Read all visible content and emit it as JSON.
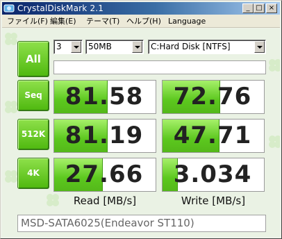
{
  "window": {
    "title": "CrystalDiskMark 2.1",
    "caption_buttons": {
      "minimize": "_",
      "maximize": "□",
      "close": "×"
    }
  },
  "menu": {
    "items": [
      "ファイル(F)",
      "編集(E)",
      "テーマ(T)",
      "ヘルプ(H)",
      "Language"
    ]
  },
  "controls": {
    "all_label": "All",
    "test_count": "3",
    "test_size": "50MB",
    "drive": "C:Hard Disk [NTFS]",
    "status": ""
  },
  "tests": {
    "seq": {
      "label": "Seq",
      "read": "81.58",
      "write": "72.76",
      "read_fill": 0.53,
      "write_fill": 0.57
    },
    "k512": {
      "label": "512K",
      "read": "81.19",
      "write": "47.71",
      "read_fill": 0.53,
      "write_fill": 0.56
    },
    "k4": {
      "label": "4K",
      "read": "27.66",
      "write": "3.034",
      "read_fill": 0.48,
      "write_fill": 0.15
    }
  },
  "columns": {
    "read": "Read [MB/s]",
    "write": "Write [MB/s]"
  },
  "comment": "MSD-SATA6025(Endeavor ST110)",
  "colors": {
    "accent": "#5cc81e",
    "titlebar": "#0a246a"
  }
}
